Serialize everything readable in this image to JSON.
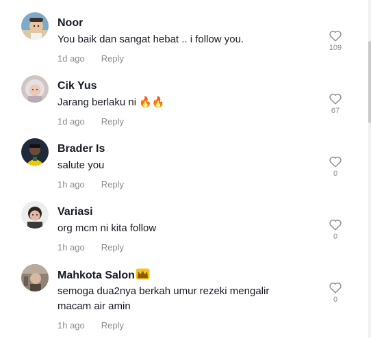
{
  "reply_label": "Reply",
  "comments": [
    {
      "username": "Noor",
      "text": "You baik dan sangat hebat .. i follow you.",
      "time": "1d ago",
      "likes": "109",
      "avatar": "avatar-child"
    },
    {
      "username": "Cik Yus",
      "text": "Jarang berlaku ni 🔥🔥",
      "time": "1d ago",
      "likes": "67",
      "avatar": "avatar-woman-hijab"
    },
    {
      "username": "Brader Is",
      "text": "salute you",
      "time": "1h ago",
      "likes": "0",
      "avatar": "avatar-man-yellow"
    },
    {
      "username": "Variasi",
      "text": "org mcm ni kita follow",
      "time": "1h ago",
      "likes": "0",
      "avatar": "avatar-woman"
    },
    {
      "username": "Mahkota Salon",
      "username_emoji": "👑",
      "text": "semoga dua2nya berkah umur rezeki mengalir macam air amin",
      "time": "1h ago",
      "likes": "0",
      "avatar": "avatar-salon"
    }
  ],
  "colors": {
    "text": "#161823",
    "muted": "#8a8b91",
    "background": "#ffffff"
  }
}
